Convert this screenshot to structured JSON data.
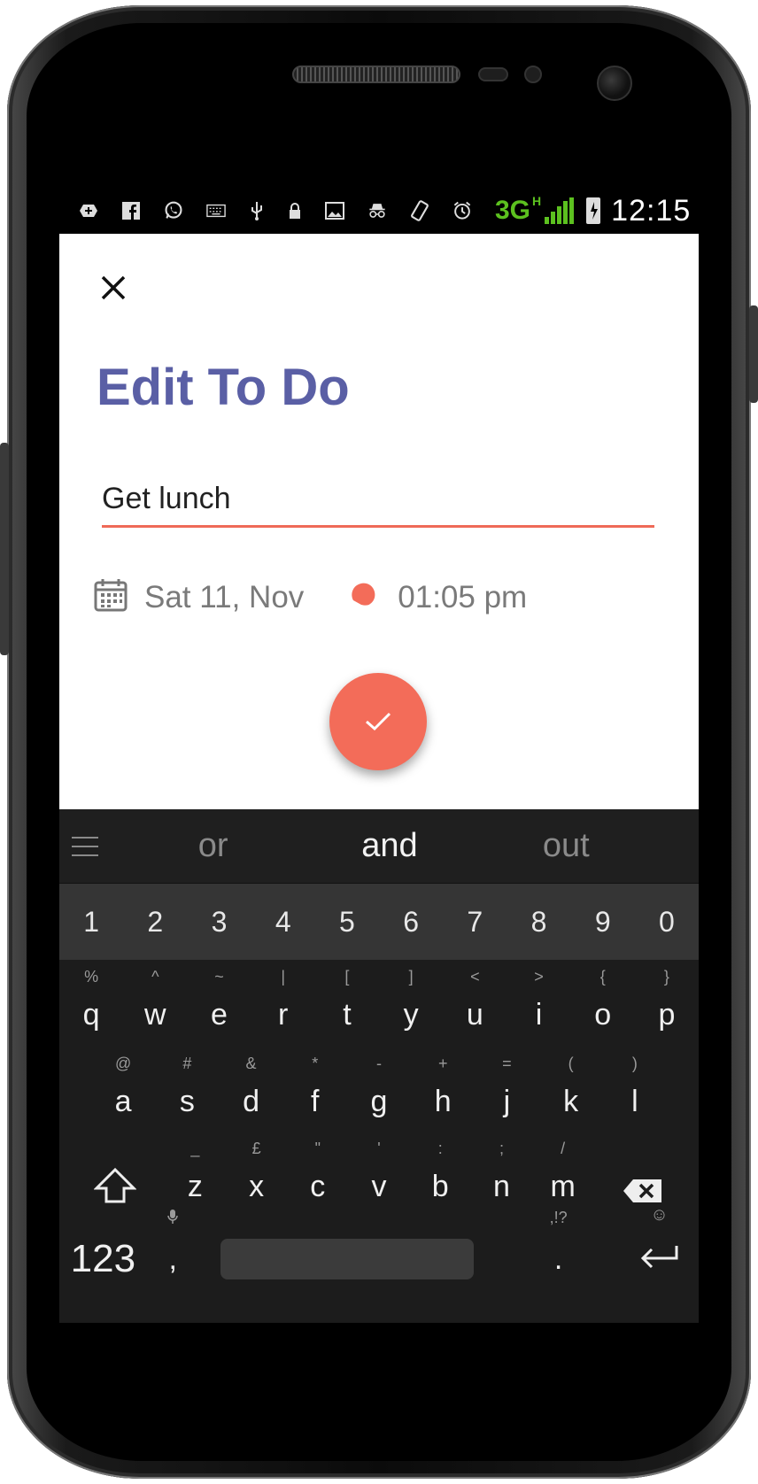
{
  "status_bar": {
    "network": "3G",
    "network_sub": "H",
    "time": "12:15"
  },
  "screen": {
    "title": "Edit To Do",
    "todo_text": "Get lunch",
    "date": "Sat 11, Nov",
    "time": "01:05 pm",
    "accent_color": "#f36c59",
    "title_color": "#5a5fa5"
  },
  "keyboard": {
    "suggestions": [
      "or",
      "and",
      "out"
    ],
    "numbers": [
      "1",
      "2",
      "3",
      "4",
      "5",
      "6",
      "7",
      "8",
      "9",
      "0"
    ],
    "row1": [
      {
        "k": "q",
        "h": "%"
      },
      {
        "k": "w",
        "h": "^"
      },
      {
        "k": "e",
        "h": "~"
      },
      {
        "k": "r",
        "h": "|"
      },
      {
        "k": "t",
        "h": "["
      },
      {
        "k": "y",
        "h": "]"
      },
      {
        "k": "u",
        "h": "<"
      },
      {
        "k": "i",
        "h": ">"
      },
      {
        "k": "o",
        "h": "{"
      },
      {
        "k": "p",
        "h": "}"
      }
    ],
    "row2": [
      {
        "k": "a",
        "h": "@"
      },
      {
        "k": "s",
        "h": "#"
      },
      {
        "k": "d",
        "h": "&"
      },
      {
        "k": "f",
        "h": "*"
      },
      {
        "k": "g",
        "h": "-"
      },
      {
        "k": "h",
        "h": "+"
      },
      {
        "k": "j",
        "h": "="
      },
      {
        "k": "k",
        "h": "("
      },
      {
        "k": "l",
        "h": ")"
      }
    ],
    "row3": [
      {
        "k": "z",
        "h": "_"
      },
      {
        "k": "x",
        "h": "£"
      },
      {
        "k": "c",
        "h": "\""
      },
      {
        "k": "v",
        "h": "'"
      },
      {
        "k": "b",
        "h": ":"
      },
      {
        "k": "n",
        "h": ";"
      },
      {
        "k": "m",
        "h": "/"
      }
    ],
    "symbols_key": "123",
    "comma_key": ",",
    "period_key": ".",
    "period_hint": ",!?",
    "enter_hint": "☺"
  }
}
